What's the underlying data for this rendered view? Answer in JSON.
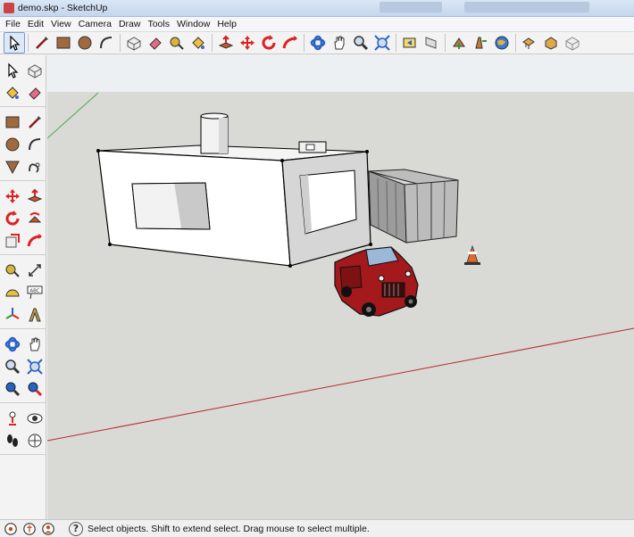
{
  "window": {
    "title": "demo.skp - SketchUp"
  },
  "menu": {
    "items": [
      {
        "label": "File"
      },
      {
        "label": "Edit"
      },
      {
        "label": "View"
      },
      {
        "label": "Camera"
      },
      {
        "label": "Draw"
      },
      {
        "label": "Tools"
      },
      {
        "label": "Window"
      },
      {
        "label": "Help"
      }
    ]
  },
  "toolbar_top": {
    "items": [
      "select-icon",
      "line-icon",
      "rectangle-icon",
      "circle-icon",
      "arc-icon",
      "make-component-icon",
      "eraser-icon",
      "tape-measure-icon",
      "paint-bucket-icon",
      "push-pull-icon",
      "move-icon",
      "rotate-icon",
      "follow-me-icon",
      "orbit-icon",
      "pan-icon",
      "zoom-icon",
      "zoom-extents-icon",
      "previous-view-icon",
      "next-view-icon",
      "get-models-icon",
      "share-model-icon",
      "google-earth-icon",
      "components-icon",
      "share-component-icon",
      "make-component-3d-icon"
    ]
  },
  "toolbar_left": {
    "items": [
      "select-icon",
      "make-component-icon",
      "paint-bucket-icon",
      "eraser-icon",
      "rectangle-icon",
      "line-icon",
      "circle-icon",
      "arc-icon",
      "polygon-icon",
      "freehand-icon",
      "move-icon",
      "push-pull-icon",
      "rotate-icon",
      "follow-me-icon",
      "scale-icon",
      "offset-icon",
      "tape-measure-icon",
      "dimension-icon",
      "protractor-icon",
      "text-icon",
      "axes-icon",
      "3d-text-icon",
      "orbit-icon",
      "pan-icon",
      "zoom-icon",
      "zoom-window-icon",
      "previous-view-icon",
      "zoom-extents-icon",
      "position-camera-icon",
      "look-around-icon",
      "walk-icon",
      "section-plane-icon"
    ]
  },
  "colors": {
    "sky": "#edf0f3",
    "ground": "#d9d9d5",
    "red_axis": "#b62a2a",
    "green_axis": "#4ca84c",
    "truck": "#a3191c"
  },
  "statusbar": {
    "icons": [
      "geo-location-icon",
      "credits-icon",
      "user-icon",
      "help-icon"
    ],
    "text": "Select objects. Shift to extend select. Drag mouse to select multiple."
  }
}
